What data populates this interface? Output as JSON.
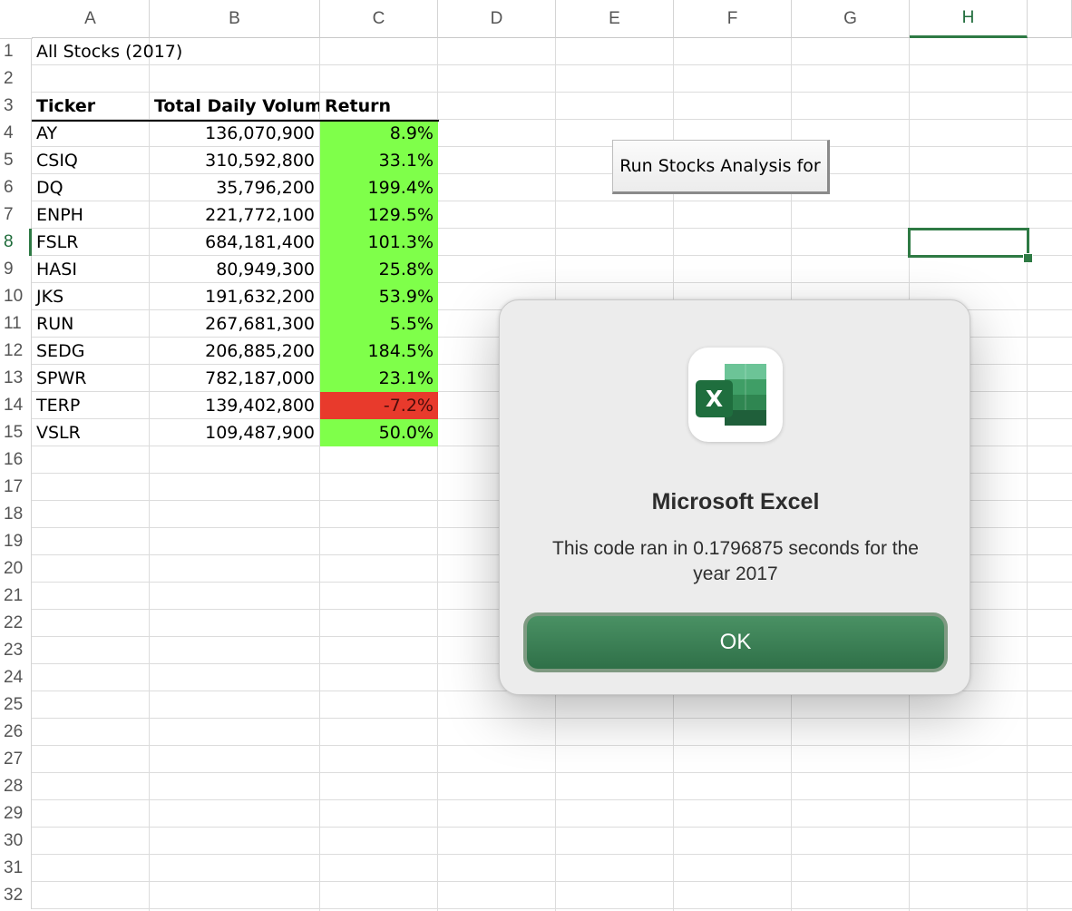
{
  "columns": [
    "A",
    "B",
    "C",
    "D",
    "E",
    "F",
    "G",
    "H"
  ],
  "selected_column": "H",
  "row_numbers": [
    "1",
    "2",
    "3",
    "4",
    "5",
    "6",
    "7",
    "8",
    "9",
    "10",
    "11",
    "12",
    "13",
    "14",
    "15",
    "16",
    "17",
    "18",
    "19",
    "20",
    "21",
    "22",
    "23",
    "24",
    "25",
    "26",
    "27",
    "28",
    "29",
    "30",
    "31",
    "32"
  ],
  "selected_row": "8",
  "sheet": {
    "title": "All Stocks (2017)",
    "headers": [
      "Ticker",
      "Total Daily Volume",
      "Return"
    ],
    "rows": [
      {
        "ticker": "AY",
        "volume": "136,070,900",
        "return": "8.9%",
        "positive": true
      },
      {
        "ticker": "CSIQ",
        "volume": "310,592,800",
        "return": "33.1%",
        "positive": true
      },
      {
        "ticker": "DQ",
        "volume": "35,796,200",
        "return": "199.4%",
        "positive": true
      },
      {
        "ticker": "ENPH",
        "volume": "221,772,100",
        "return": "129.5%",
        "positive": true
      },
      {
        "ticker": "FSLR",
        "volume": "684,181,400",
        "return": "101.3%",
        "positive": true
      },
      {
        "ticker": "HASI",
        "volume": "80,949,300",
        "return": "25.8%",
        "positive": true
      },
      {
        "ticker": "JKS",
        "volume": "191,632,200",
        "return": "53.9%",
        "positive": true
      },
      {
        "ticker": "RUN",
        "volume": "267,681,300",
        "return": "5.5%",
        "positive": true
      },
      {
        "ticker": "SEDG",
        "volume": "206,885,200",
        "return": "184.5%",
        "positive": true
      },
      {
        "ticker": "SPWR",
        "volume": "782,187,000",
        "return": "23.1%",
        "positive": true
      },
      {
        "ticker": "TERP",
        "volume": "139,402,800",
        "return": "-7.2%",
        "positive": false
      },
      {
        "ticker": "VSLR",
        "volume": "109,487,900",
        "return": "50.0%",
        "positive": true
      }
    ]
  },
  "run_button_label": "Run Stocks Analysis for",
  "dialog": {
    "title": "Microsoft Excel",
    "message": "This code ran in 0.1796875 seconds for the year 2017",
    "ok_label": "OK",
    "icon": "excel-app-icon",
    "icon_letter": "X"
  },
  "colors": {
    "positive_fill": "#7fff4a",
    "negative_fill": "#e83a2c",
    "excel_green": "#2e7a44"
  }
}
